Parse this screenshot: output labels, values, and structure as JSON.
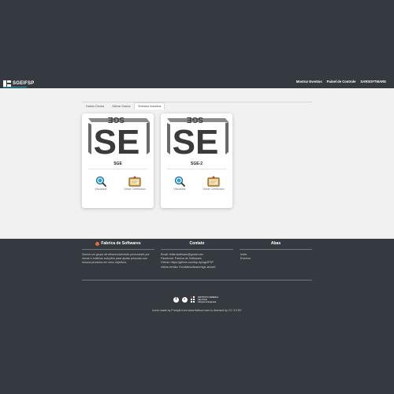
{
  "header": {
    "brand": "SGEIFSP",
    "nav": [
      "Mostrar Eventos",
      "Painel de Controle",
      "SARSOFTWARE"
    ]
  },
  "tabs": [
    {
      "label": "Dados Gerais",
      "active": false
    },
    {
      "label": "Alterar Dados",
      "active": false
    },
    {
      "label": "Eventos Inscritos",
      "active": true
    }
  ],
  "events": [
    {
      "title": "SGE",
      "view_label": "Visualizar",
      "cert_label": "Gerar Certificado"
    },
    {
      "title": "SGE-2",
      "view_label": "Visualizar",
      "cert_label": "Gerar Certificado"
    }
  ],
  "logo_text": {
    "top": "SGE",
    "main": "SE"
  },
  "footer": {
    "about": {
      "title": "Fabrica de Softwares",
      "text": "Somos um grupo de desenvolvimento procurando por novas e criativas soluções para ajudar pessoas com nossos produtos em seus objetivos."
    },
    "contact": {
      "title": "Contato",
      "lines": [
        "Email: fsifsrosoftware@gmail.com",
        "Facebook: Fabrica de Softwares",
        "Github: https://github.com/fsp-rtp/sgeIFSP",
        "ultima versão: Ecrabils/software/sge-laravel"
      ]
    },
    "tabs": {
      "title": "Abas",
      "links": [
        "Inicio",
        "Eventos"
      ]
    },
    "social": {
      "facebook": "f",
      "github": "◐"
    },
    "ifsp": [
      "INSTITUTO FEDERAL",
      "São Paulo",
      "Câmpus Araraquara"
    ],
    "credit": "Icons made by Freepik from www.flaticon.com is licensed by CC 3.0 BY"
  },
  "colors": {
    "dark": "#343a40",
    "content_bg": "#f1f1f1",
    "accent": "#17a2b8",
    "logo_ink": "#3a3a3a"
  }
}
